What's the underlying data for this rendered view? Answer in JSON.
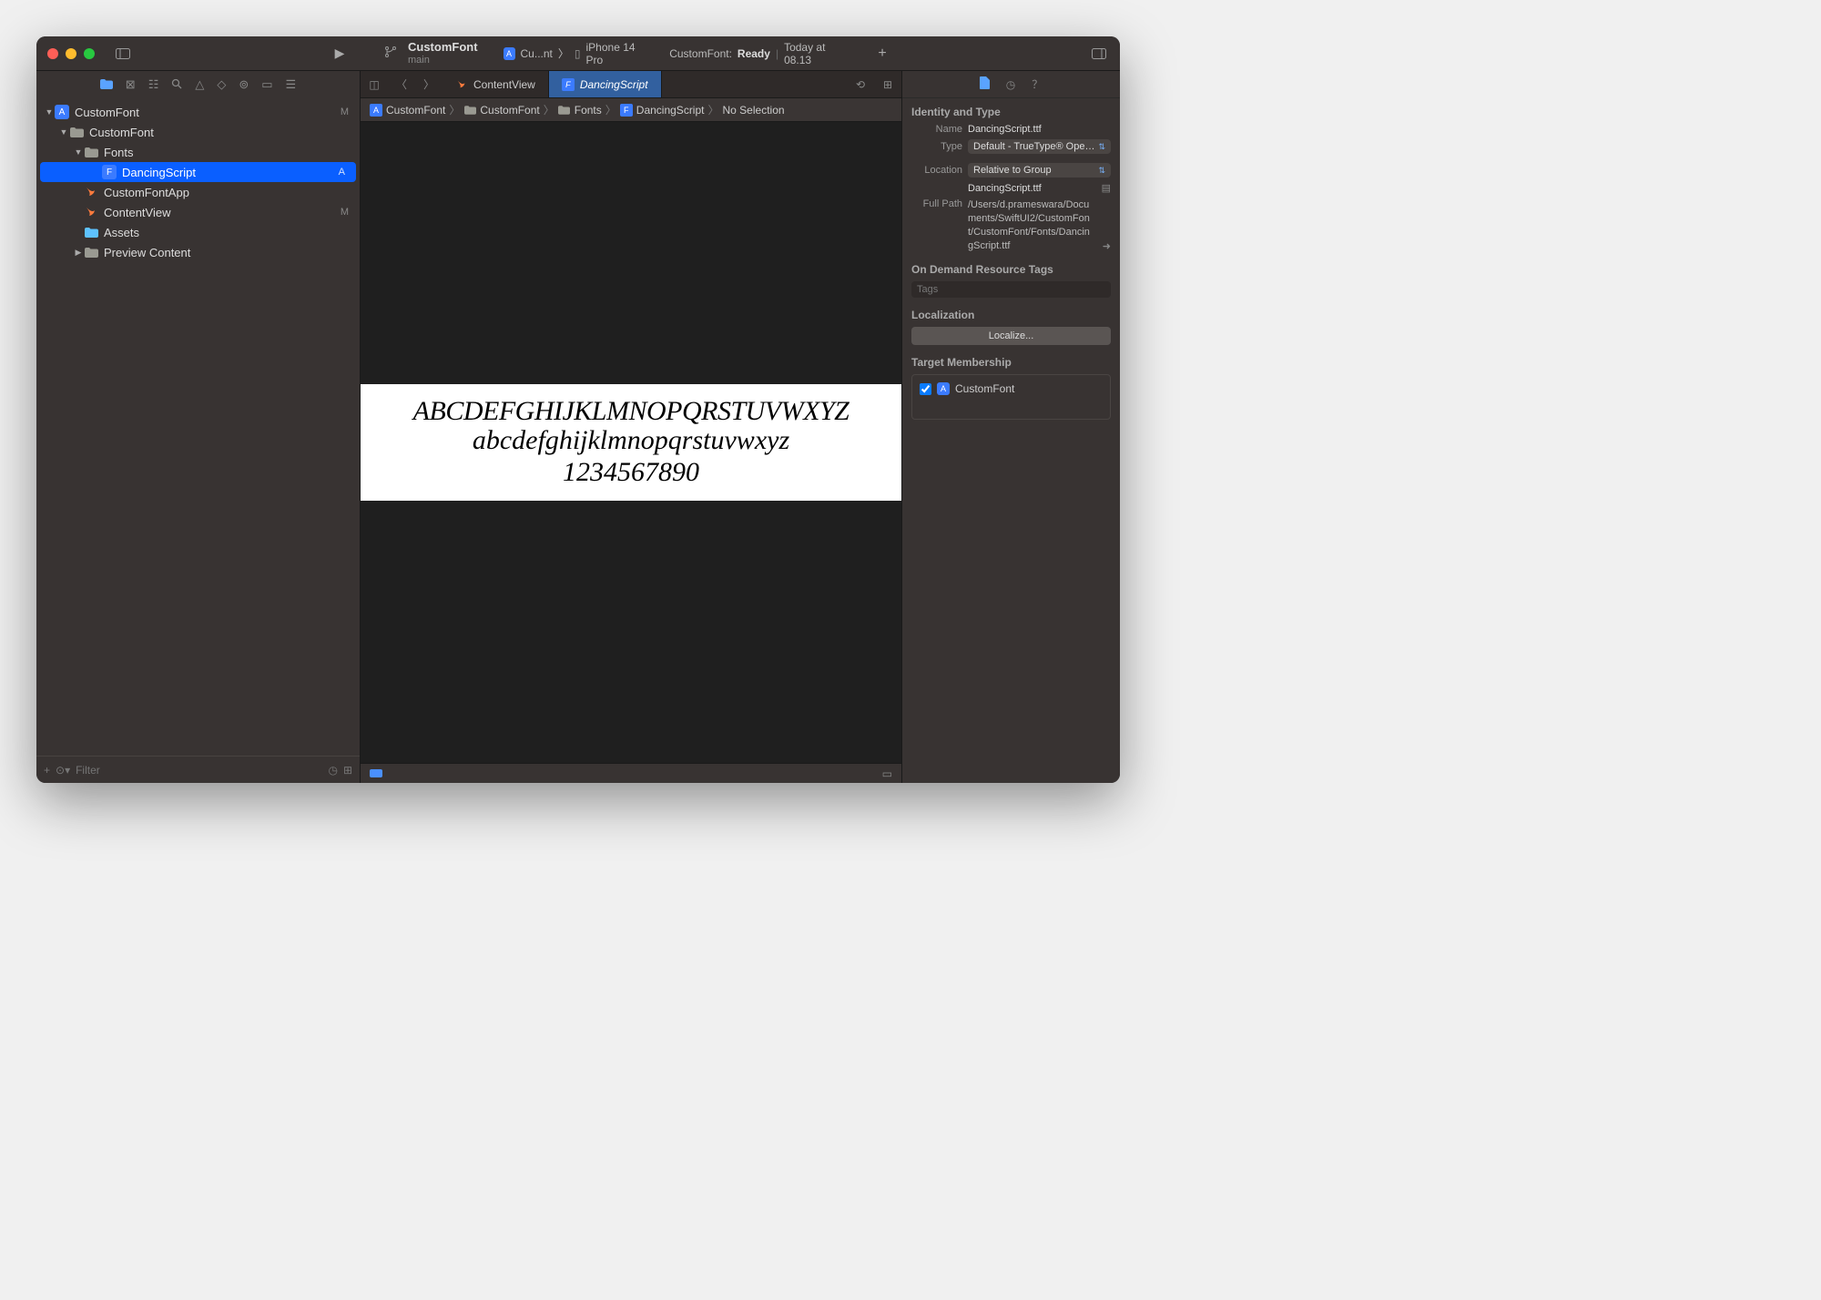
{
  "toolbar": {
    "title": "CustomFont",
    "branch": "main",
    "scheme": "Cu...nt",
    "device": "iPhone 14 Pro",
    "status_prefix": "CustomFont:",
    "status_state": "Ready",
    "status_time": "Today at 08.13"
  },
  "navigator": {
    "items": [
      {
        "label": "CustomFont",
        "depth": 0,
        "icon": "proj",
        "open": true,
        "status": "M"
      },
      {
        "label": "CustomFont",
        "depth": 1,
        "icon": "folder",
        "open": true,
        "status": ""
      },
      {
        "label": "Fonts",
        "depth": 2,
        "icon": "folder",
        "open": true,
        "status": ""
      },
      {
        "label": "DancingScript",
        "depth": 3,
        "icon": "font",
        "open": false,
        "status": "A",
        "selected": true
      },
      {
        "label": "CustomFontApp",
        "depth": 2,
        "icon": "swift",
        "open": false,
        "status": ""
      },
      {
        "label": "ContentView",
        "depth": 2,
        "icon": "swift",
        "open": false,
        "status": "M"
      },
      {
        "label": "Assets",
        "depth": 2,
        "icon": "assets",
        "open": false,
        "status": ""
      },
      {
        "label": "Preview Content",
        "depth": 2,
        "icon": "folder",
        "open": false,
        "status": "",
        "closed": true
      }
    ],
    "filter_placeholder": "Filter"
  },
  "tabs": [
    {
      "label": "ContentView",
      "icon": "swift",
      "active": false
    },
    {
      "label": "DancingScript",
      "icon": "font",
      "active": true
    }
  ],
  "breadcrumb": [
    {
      "label": "CustomFont",
      "icon": "proj"
    },
    {
      "label": "CustomFont",
      "icon": "folder"
    },
    {
      "label": "Fonts",
      "icon": "folder"
    },
    {
      "label": "DancingScript",
      "icon": "font"
    },
    {
      "label": "No Selection",
      "icon": ""
    }
  ],
  "preview": {
    "line1": "ABCDEFGHIJKLMNOPQRSTUVWXYZ",
    "line2": "abcdefghijklmnopqrstuvwxyz",
    "line3": "1234567890"
  },
  "inspector": {
    "section_identity": "Identity and Type",
    "name_label": "Name",
    "name_value": "DancingScript.ttf",
    "type_label": "Type",
    "type_value": "Default - TrueType® Open...",
    "location_label": "Location",
    "location_value": "Relative to Group",
    "location_file": "DancingScript.ttf",
    "fullpath_label": "Full Path",
    "fullpath_value": "/Users/d.prameswara/Documents/SwiftUI2/CustomFont/CustomFont/Fonts/DancingScript.ttf",
    "section_odr": "On Demand Resource Tags",
    "tags_placeholder": "Tags",
    "section_loc": "Localization",
    "localize_btn": "Localize...",
    "section_target": "Target Membership",
    "target_name": "CustomFont"
  }
}
